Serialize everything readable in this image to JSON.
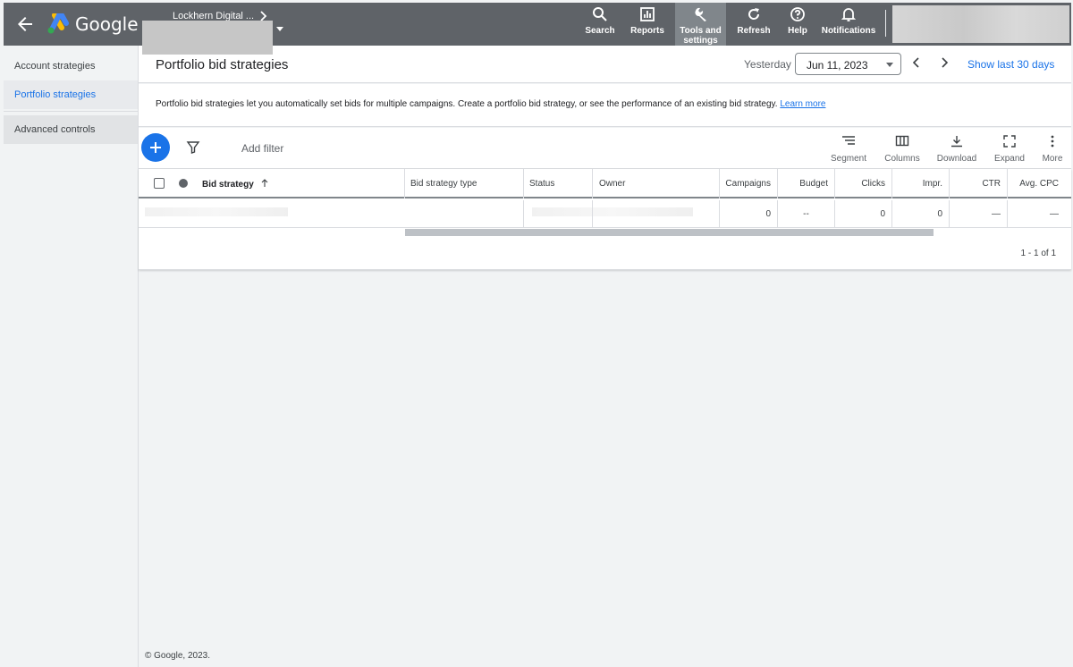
{
  "topbar": {
    "product_name": "Google Ads",
    "account_name": "Lockhern Digital ...",
    "nav": [
      {
        "label": "Search",
        "icon": "search-icon"
      },
      {
        "label": "Reports",
        "icon": "reports-icon"
      },
      {
        "label": "Tools and settings",
        "icon": "wrench-icon",
        "active": true
      },
      {
        "label": "Refresh",
        "icon": "refresh-icon"
      },
      {
        "label": "Help",
        "icon": "help-icon"
      },
      {
        "label": "Notifications",
        "icon": "bell-icon"
      }
    ]
  },
  "sidebar": {
    "items": [
      {
        "label": "Account strategies"
      },
      {
        "label": "Portfolio strategies",
        "active": true
      },
      {
        "label": "Advanced controls"
      }
    ]
  },
  "header": {
    "title": "Portfolio bid strategies",
    "date_label": "Yesterday",
    "date_value": "Jun 11, 2023",
    "show_last": "Show last 30 days"
  },
  "info": {
    "text": "Portfolio bid strategies let you automatically set bids for multiple campaigns. Create a portfolio bid strategy, or see the performance of an existing bid strategy. ",
    "link": "Learn more"
  },
  "toolbar": {
    "add_filter": "Add filter",
    "buttons": [
      "Segment",
      "Columns",
      "Download",
      "Expand",
      "More"
    ]
  },
  "table": {
    "columns": [
      "Bid strategy",
      "Bid strategy type",
      "Status",
      "Owner",
      "Campaigns",
      "Budget",
      "Clicks",
      "Impr.",
      "CTR",
      "Avg. CPC"
    ],
    "row": {
      "campaigns": "0",
      "budget": "--",
      "clicks": "0",
      "impr": "0",
      "ctr": "—",
      "avg_cpc": "—"
    },
    "pagination": "1 - 1 of 1"
  },
  "footer": "© Google, 2023.",
  "colors": {
    "topbar": "#5f6368",
    "accent": "#1a73e8"
  }
}
